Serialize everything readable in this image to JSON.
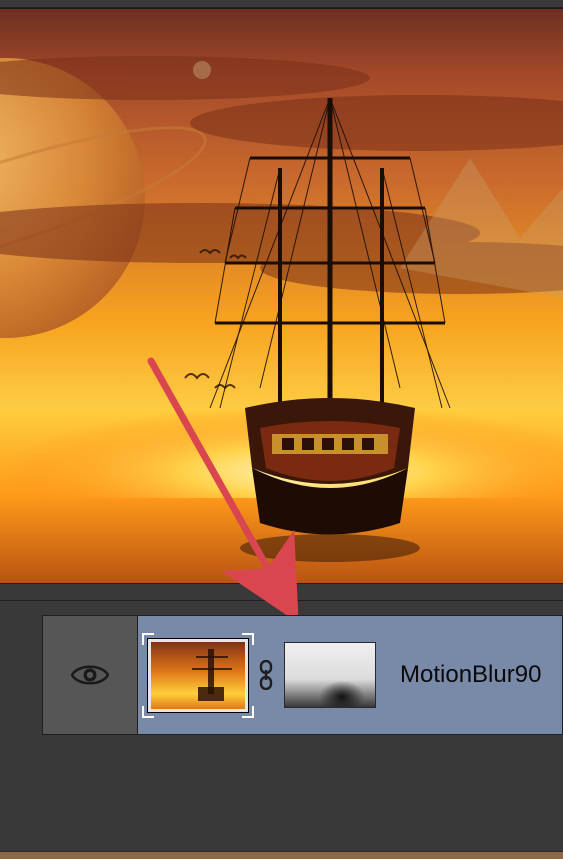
{
  "layer": {
    "name": "MotionBlur90",
    "visible": true
  },
  "icons": {
    "eye": "eye-icon",
    "link": "link-icon"
  },
  "colors": {
    "panel_bg": "#393939",
    "layer_row_bg": "#7989a8",
    "visibility_bg": "#565656",
    "arrow": "#d9464f"
  }
}
